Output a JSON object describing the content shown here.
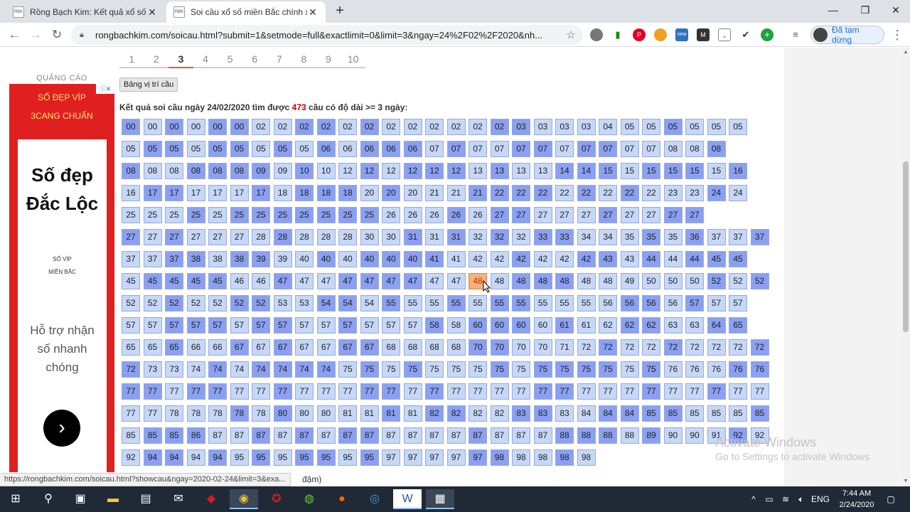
{
  "browser": {
    "tabs": [
      {
        "title": "Rồng Bạch Kim: Kết quả xổ số m",
        "favicon": "RBK"
      },
      {
        "title": "Soi cầu xổ số miền Bắc chính xác",
        "favicon": "RBK"
      }
    ],
    "url": "rongbachkim.com/soicau.html?submit=1&setmode=full&exactlimit=0&limit=3&ngay=24%2F02%2F2020&nh...",
    "profile_label": "Đã tạm dừng",
    "extension_icons": [
      "extension-1-icon",
      "chart-icon",
      "pinterest-icon",
      "extension-4-icon",
      "new-icon",
      "mail-icon",
      "pocket-icon",
      "check-icon",
      "plus-icon"
    ]
  },
  "page": {
    "pagination": [
      "1",
      "2",
      "3",
      "4",
      "5",
      "6",
      "7",
      "8",
      "9",
      "10"
    ],
    "current_page": "3",
    "position_button": "Bảng vị trí cầu",
    "summary_prefix": "Kết quả soi cầu ngày 24/02/2020 tìm được ",
    "summary_count": "473",
    "summary_suffix": " cầu có độ dài >= 3 ngày:",
    "ad": {
      "label": "QUẢNG CÁO",
      "top1": "SỐ ĐẸP VÍP",
      "top2": "3CANG CHUẨN",
      "headline": "Số đẹp Đắc Lộc",
      "small1": "SỐ VÍP",
      "small2": "MIỀN BẮC",
      "support": "Hỗ trợ nhận số nhanh chóng"
    },
    "status_url": "https://rongbachkim.com/soicau.html?showcau&ngay=2020-02-24&limit=3&exa...",
    "status_tail": "đậm)",
    "watermark_title": "Activate Windows",
    "watermark_sub": "Go to Settings to activate Windows",
    "grid_rows": [
      "00d 00l 00d 00l 00d 00d 02l 02l 02d 02d 02l 02d 02l 02l 02l 02l 02l 02d 03d 03l 03l 03l 04l 05l 05l 05d 05l 05l 05l",
      "05l 05d 05d 05l 05d 05d 05l 05d 05l 06d 06l 06d 06d 06d 07l 07d 07l 07l 07d 07d 07l 07d 07d 07l 07l 08l 08l 08d",
      "08d 08l 08l 08d 08d 08d 09d 09l 10d 10l 12l 12d 12l 12d 12d 12d 13l 13d 13l 13l 14d 14d 15d 15l 15d 15d 15d 15l 16d",
      "16l 17d 17d 17l 17l 17l 17d 18l 18d 18d 18d 20l 20d 20l 21l 21l 21d 22d 22d 22d 22l 22d 22l 22d 22l 23l 23l 24d 24l",
      "25l 25l 25l 25d 25l 25d 25d 25d 25d 25d 25d 25d 26l 26l 26l 26d 26l 27d 27d 27l 27l 27l 27d 27l 27l 27d 27d",
      "27d 27l 27d 27l 27l 27l 28l 28d 28l 28l 28l 30l 30l 31d 31l 31d 32l 32d 32l 33d 33d 34l 34l 35l 35d 35l 36d 37l 37l 37d",
      "37l 37l 37d 38d 38l 38d 39d 39l 40l 40d 40l 40d 40d 40d 41d 41l 42l 42l 42d 42l 42l 42d 43d 43l 44d 44l 44d 45d 45d",
      "45l 45d 45d 45d 45d 46l 46l 47d 47l 47l 47d 47d 47d 47d 47l 47l 48h 48l 48d 48d 48d 48l 48l 49l 50l 50l 50l 52d 52l 52d",
      "52l 52l 52d 52l 52l 52d 52d 53l 53l 54d 54d 54l 55d 55l 55l 55d 55l 55d 55d 55l 55l 55l 56l 56d 56d 56l 57d 57l 57l",
      "57l 57l 57d 57d 57d 57l 57d 57d 57l 57l 57d 57l 57l 57l 58d 58l 60d 60d 60d 60l 61d 61l 62l 62d 62d 63l 63l 64d 65d",
      "65l 65l 65d 66l 66l 67d 67l 67d 67l 67l 67d 67d 68l 68l 68l 68l 70d 70d 70l 70l 71l 72l 72d 72l 72l 72d 72l 72l 72l 72d",
      "72d 73l 73l 74l 74d 74l 74d 74d 74d 74d 75l 75d 75l 75d 75l 75l 75l 75d 75l 75d 75d 75d 75d 75l 75d 76l 76l 76l 76d 76d",
      "77d 77d 77l 77d 77d 77l 77l 77d 77l 77l 77l 77d 77d 77l 77d 77l 77l 77l 77l 77d 77d 77l 77l 77l 77d 77l 77l 77d 77l 77l",
      "77l 77l 78l 78l 78l 78d 78l 80d 80l 80l 81l 81l 81d 81l 82d 82d 82l 82l 83d 83d 83l 84l 84d 84d 85d 85d 85l 85l 85l 85d",
      "85l 85d 85d 86d 87l 87l 87d 87l 87d 87l 87d 87d 87l 87l 87l 87l 87d 87l 87l 87l 88d 88d 88d 88l 89d 90l 90l 91l 92d 92l",
      "92l 94d 94d 94l 94d 95l 95d 95l 95d 95d 95l 95d 97l 97l 97l 97l 97d 98d 98l 98l 98d 98l"
    ],
    "taskbar": {
      "clock_time": "7:44 AM",
      "clock_date": "2/24/2020",
      "lang": "ENG"
    }
  }
}
